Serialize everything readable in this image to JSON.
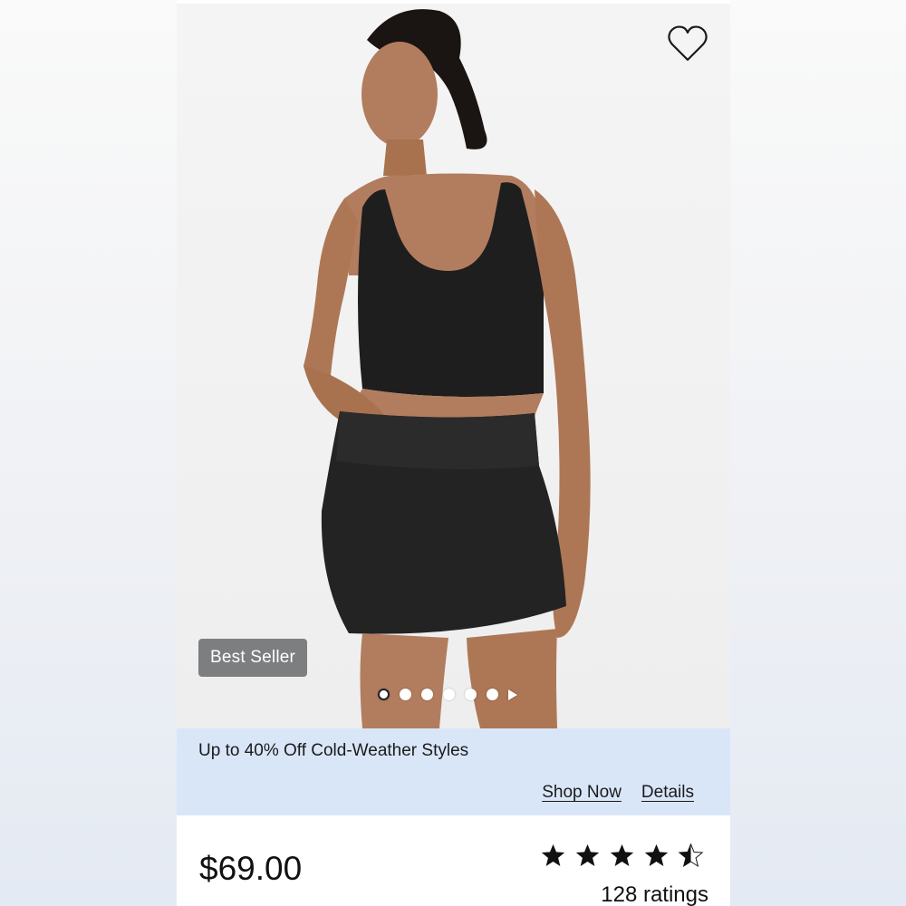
{
  "product": {
    "badge": "Best Seller",
    "price": "$69.00",
    "rating_value": 4.5,
    "rating_max": 5,
    "ratings_count": "128 ratings",
    "favorite_icon": "heart-outline-icon"
  },
  "carousel": {
    "image_count": 6,
    "active_index": 0,
    "next_icon": "play-right-icon"
  },
  "promo": {
    "text": "Up to 40% Off Cold-Weather Styles",
    "links": [
      "Shop Now",
      "Details"
    ],
    "background": "#d9e6f8"
  },
  "colors": {
    "badge_bg": "#7d7e80",
    "text": "#111111",
    "garment": "#1e1e1f",
    "skin": "#b27d5e"
  }
}
